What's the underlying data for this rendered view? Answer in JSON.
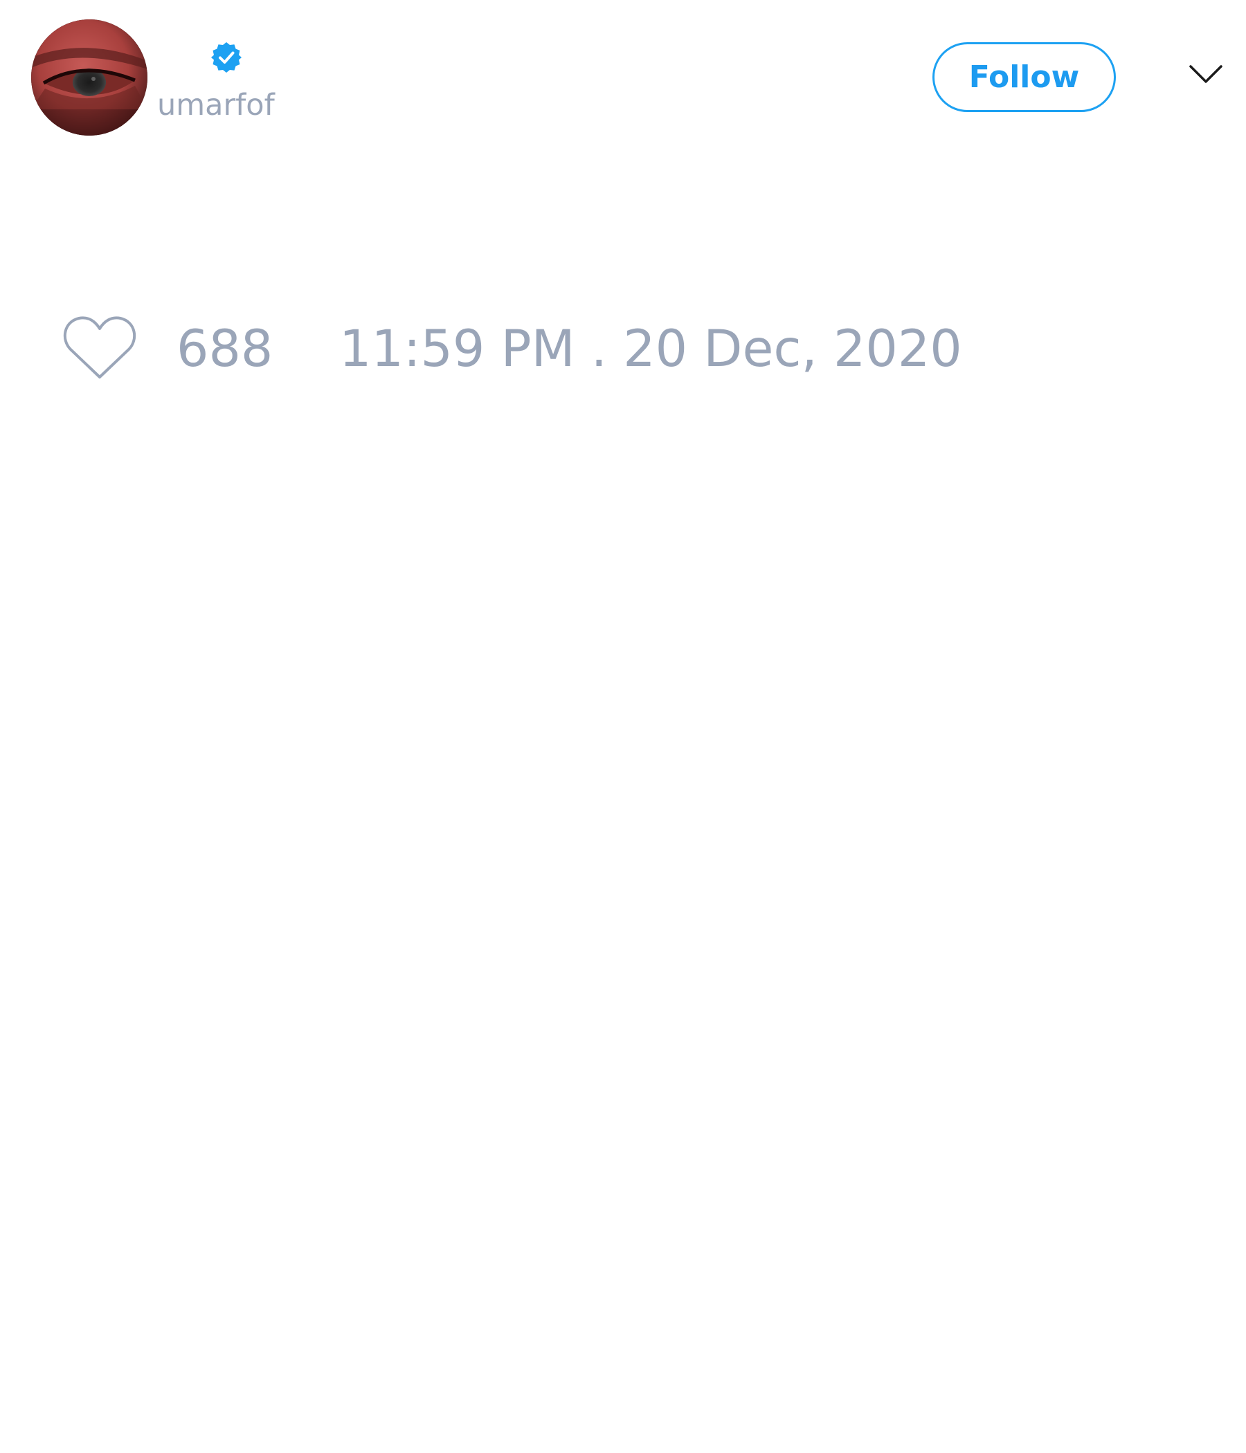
{
  "tweet": {
    "author": {
      "handle": "umarfof",
      "verified": true,
      "avatar_icon": "avatar-eye-red"
    },
    "follow_label": "Follow",
    "menu_icon": "chevron-down-icon",
    "like_icon": "heart-outline-icon",
    "like_count": "688",
    "timestamp": "11:59 PM . 20 Dec, 2020"
  },
  "colors": {
    "accent": "#1da1f2",
    "muted_text": "#9aa5b8",
    "background": "#ffffff"
  }
}
